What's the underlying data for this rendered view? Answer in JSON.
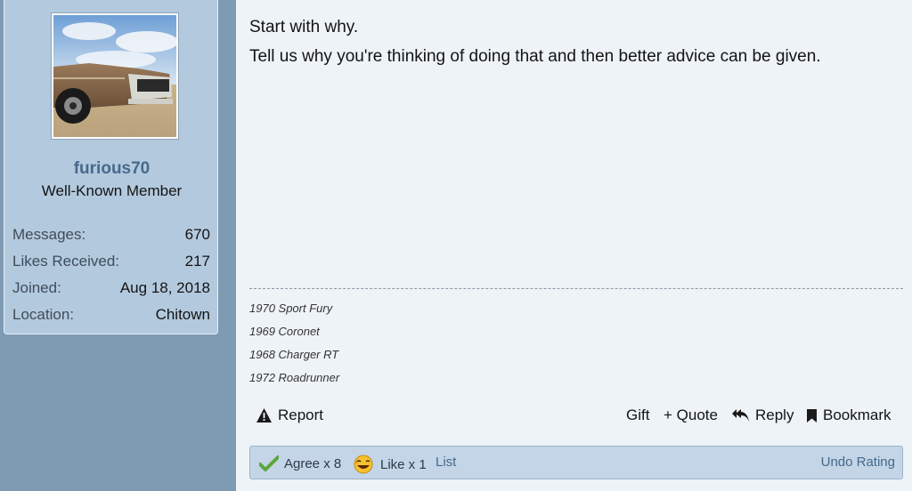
{
  "user": {
    "username": "furious70",
    "title": "Well-Known Member",
    "stats": [
      {
        "label": "Messages:",
        "value": "670"
      },
      {
        "label": "Likes Received:",
        "value": "217"
      },
      {
        "label": "Joined:",
        "value": "Aug 18, 2018"
      },
      {
        "label": "Location:",
        "value": "Chitown"
      }
    ]
  },
  "post": {
    "lines": [
      "Start with why.",
      "Tell us why you're thinking of doing that and then better advice can be given."
    ],
    "signature": [
      "1970 Sport Fury",
      "1969 Coronet",
      "1968 Charger RT",
      "1972 Roadrunner"
    ]
  },
  "actions": {
    "report": "Report",
    "gift": "Gift",
    "quote": "+ Quote",
    "reply": "Reply",
    "bookmark": "Bookmark"
  },
  "reactions": {
    "agree": "Agree x 8",
    "like": "Like x 1",
    "list": "List",
    "undo": "Undo Rating"
  },
  "colors": {
    "sidebar_bg": "#7f9ab3",
    "card_bg": "#b3c9de",
    "username": "#47698c",
    "main_bg": "#eef3f8",
    "reaction_bar": "#c3d5e6"
  }
}
